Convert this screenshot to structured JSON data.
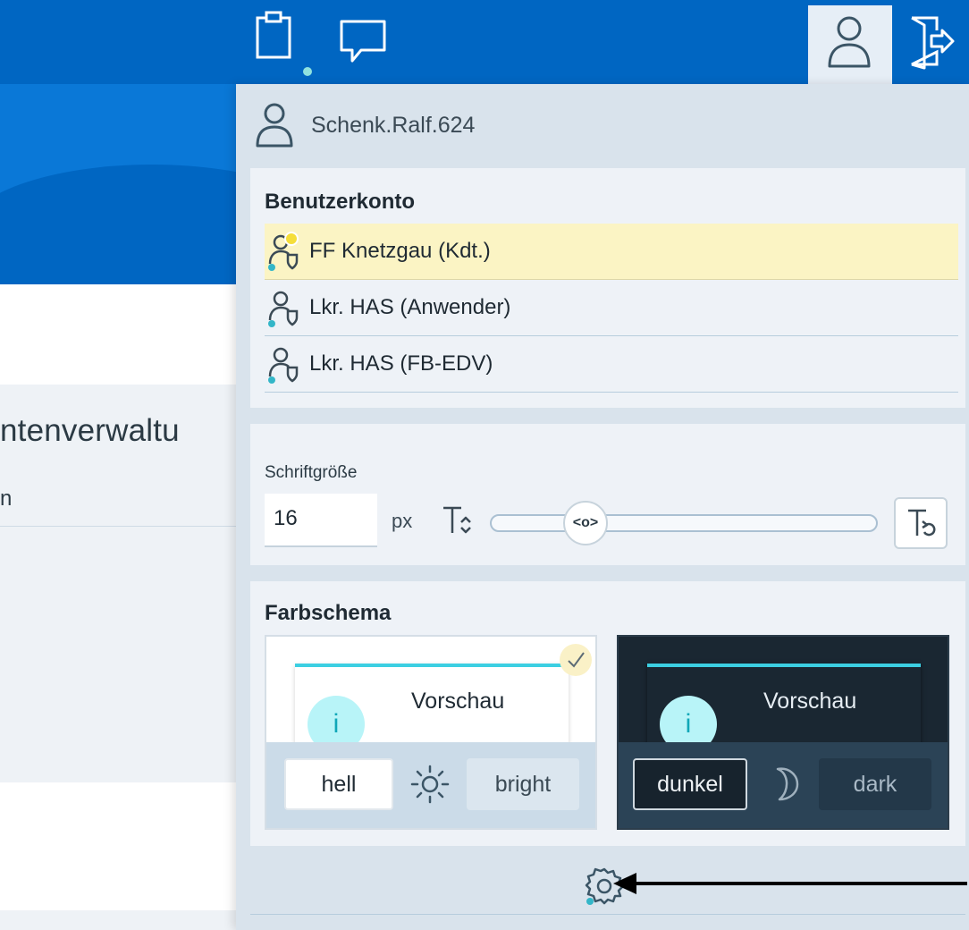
{
  "header": {
    "clipboard_icon": "clipboard-icon",
    "chat_icon": "chat-icon",
    "user_icon": "user-icon",
    "logout_icon": "logout-icon",
    "background_color": "#0066c2"
  },
  "background_page": {
    "title_fragment": "ntenverwaltu",
    "subtitle_fragment": "n"
  },
  "user_menu": {
    "username": "Schenk.Ralf.624",
    "accounts": {
      "title": "Benutzerkonto",
      "items": [
        {
          "label": "FF Knetzgau (Kdt.)",
          "active": true
        },
        {
          "label": "Lkr. HAS (Anwender)",
          "active": false
        },
        {
          "label": "Lkr. HAS (FB-EDV)",
          "active": false
        }
      ]
    },
    "font_size": {
      "label": "Schriftgröße",
      "value": "16",
      "unit": "px",
      "slider_thumb": "<o>"
    },
    "color_scheme": {
      "title": "Farbschema",
      "light": {
        "preview_text": "Vorschau",
        "info_glyph": "i",
        "button_label": "hell",
        "alt_label": "bright",
        "selected": true
      },
      "dark": {
        "preview_text": "Vorschau",
        "info_glyph": "i",
        "button_label": "dunkel",
        "alt_label": "dark",
        "selected": false
      }
    },
    "settings_icon": "gear-icon"
  }
}
